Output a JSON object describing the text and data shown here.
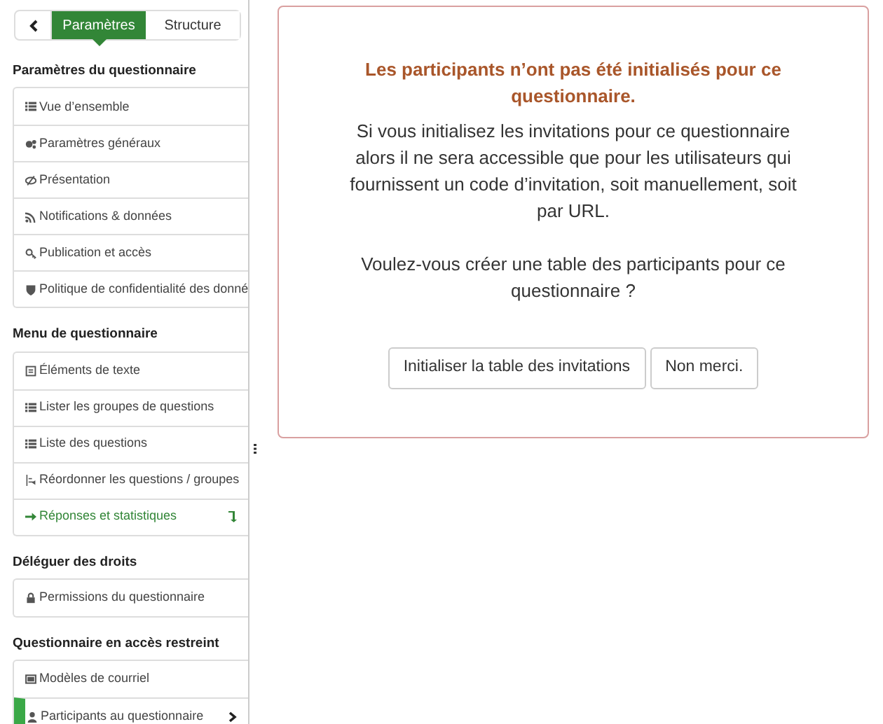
{
  "tabs": [
    {
      "label": "Paramètres",
      "selected": true
    },
    {
      "label": "Structure",
      "selected": false
    }
  ],
  "sections": [
    {
      "title": "Paramètres du questionnaire",
      "items": [
        {
          "label": "Vue d’ensemble",
          "kind": "plain",
          "selected": false
        },
        {
          "label": "Paramètres généraux",
          "kind": "plain",
          "selected": false
        },
        {
          "label": "Présentation",
          "kind": "plain",
          "selected": false
        },
        {
          "label": "Notifications & données",
          "kind": "plain",
          "selected": false
        },
        {
          "label": "Publication et accès",
          "kind": "plain",
          "selected": false
        },
        {
          "label": "Politique de confidentialité des donné",
          "kind": "plain",
          "selected": false
        }
      ]
    },
    {
      "title": "Menu de questionnaire",
      "items": [
        {
          "label": "Éléments de texte",
          "kind": "plain",
          "selected": false
        },
        {
          "label": "Lister les groupes de questions",
          "kind": "plain",
          "selected": false
        },
        {
          "label": "Liste des questions",
          "kind": "plain",
          "selected": false
        },
        {
          "label": "Réordonner les questions / groupes",
          "kind": "plain",
          "selected": false
        },
        {
          "label": "Réponses et statistiques",
          "kind": "external",
          "selected": false
        }
      ]
    },
    {
      "title": "Déléguer des droits",
      "items": [
        {
          "label": "Permissions du questionnaire",
          "kind": "plain",
          "selected": false
        }
      ]
    },
    {
      "title": "Questionnaire en accès restreint",
      "items": [
        {
          "label": "Modèles de courriel",
          "kind": "plain",
          "selected": false
        },
        {
          "label": "Participants au questionnaire",
          "kind": "plain",
          "selected": true
        }
      ]
    }
  ],
  "alert": {
    "title": "Les participants n’ont pas été initialisés pour ce questionnaire.",
    "message": "Si vous initialisez les invitations pour ce questionnaire alors il ne sera accessible que pour les utilisateurs qui fournissent un code d’invitation, soit manuellement, soit par URL.",
    "question": "Voulez-vous créer une table des participants pour ce questionnaire ?",
    "buttons": [
      "Initialiser la table des invitations",
      "Non merci."
    ]
  }
}
